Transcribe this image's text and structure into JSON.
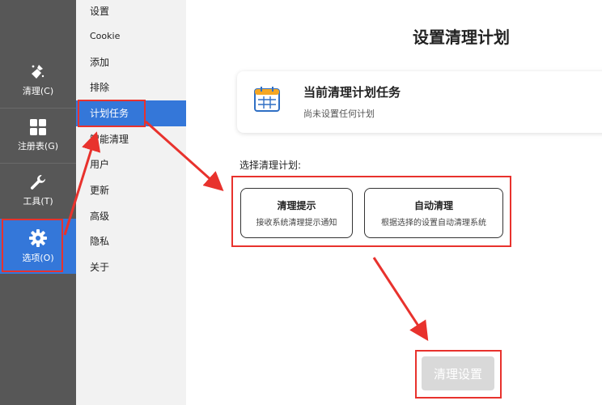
{
  "sidebar": {
    "items": [
      {
        "label": "清理(C)",
        "icon": "broom-icon"
      },
      {
        "label": "注册表(G)",
        "icon": "grid-icon"
      },
      {
        "label": "工具(T)",
        "icon": "wrench-icon"
      },
      {
        "label": "选项(O)",
        "icon": "gear-icon",
        "active": true
      }
    ]
  },
  "submenu": {
    "items": [
      "设置",
      "Cookie",
      "添加",
      "排除",
      "计划任务",
      "智能清理",
      "用户",
      "更新",
      "高级",
      "隐私",
      "关于"
    ],
    "active": "计划任务"
  },
  "main": {
    "title": "设置清理计划",
    "task_card": {
      "title": "当前清理计划任务",
      "subtitle": "尚未设置任何计划",
      "icon": "calendar-icon"
    },
    "section_label": "选择清理计划:",
    "options": [
      {
        "title": "清理提示",
        "desc": "接收系统清理提示通知"
      },
      {
        "title": "自动清理",
        "desc": "根据选择的设置自动清理系统"
      }
    ],
    "apply_label": "清理设置"
  },
  "colors": {
    "sidebar_bg": "#575757",
    "accent": "#3477d9",
    "highlight": "#e8322d",
    "submenu_bg": "#f2f2f2"
  }
}
